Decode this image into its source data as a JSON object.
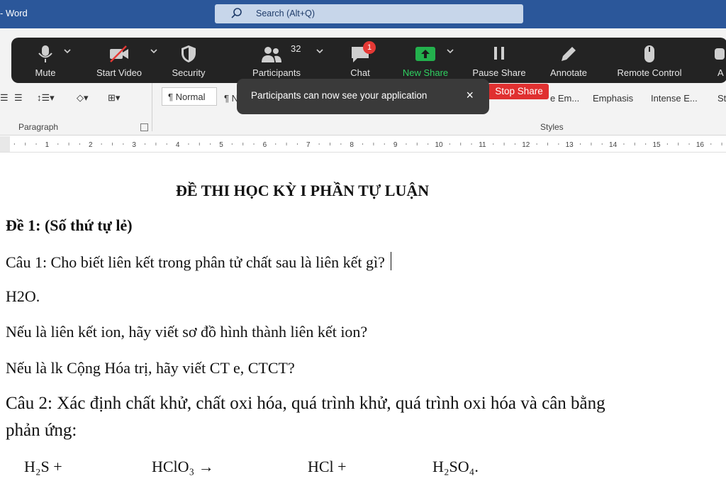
{
  "app": {
    "title": "- Word"
  },
  "search": {
    "label": "Search (Alt+Q)"
  },
  "ribbon": {
    "paragraph_label": "Paragraph",
    "styles_label": "Styles",
    "styles": [
      "¶ Normal",
      "¶ No",
      "e Em...",
      "Emphasis",
      "Intense E...",
      "St"
    ]
  },
  "ruler": {
    "numbers": [
      "1",
      "2",
      "3",
      "4",
      "5",
      "6",
      "7",
      "8",
      "9",
      "10",
      "11",
      "12",
      "13",
      "14",
      "15",
      "16"
    ]
  },
  "zoom_toolbar": {
    "items": [
      {
        "label": "Mute",
        "icon": "microphone-icon"
      },
      {
        "label": "Start Video",
        "icon": "video-off-icon"
      },
      {
        "label": "Security",
        "icon": "shield-icon"
      },
      {
        "label": "Participants",
        "icon": "participants-icon",
        "count": "32"
      },
      {
        "label": "Chat",
        "icon": "chat-icon",
        "badge": "1"
      },
      {
        "label": "New Share",
        "icon": "share-arrow-icon"
      },
      {
        "label": "Pause Share",
        "icon": "pause-icon"
      },
      {
        "label": "Annotate",
        "icon": "pencil-icon"
      },
      {
        "label": "Remote Control",
        "icon": "mouse-icon"
      },
      {
        "label": "A",
        "icon": "more-icon"
      }
    ],
    "new_share_color": "#23b14d",
    "chat_badge_color": "#e53935"
  },
  "notification": {
    "text": "Participants can now see your application",
    "close": "×"
  },
  "stop_share": {
    "label": "Stop Share",
    "color": "#e03030"
  },
  "document": {
    "title": "ĐỀ THI HỌC KỲ I PHẦN TỰ LUẬN",
    "lines": [
      "Đề 1: (Số thứ tự lẻ)",
      "Câu 1: Cho biết liên kết trong phân tử chất sau là liên kết gì?",
      "H2O.",
      "Nếu là liên kết ion, hãy viết sơ đồ hình thành liên kết ion?",
      "Nếu là lk Cộng Hóa trị, hãy viết CT e, CTCT?",
      "Câu 2: Xác định chất khử, chất oxi hóa, quá trình khử, quá trình oxi hóa và cân bằng",
      "phản ứng:"
    ],
    "formula": [
      "H₂S +",
      "HClO₃ →",
      "HCl +",
      "H₂SO₄."
    ]
  }
}
